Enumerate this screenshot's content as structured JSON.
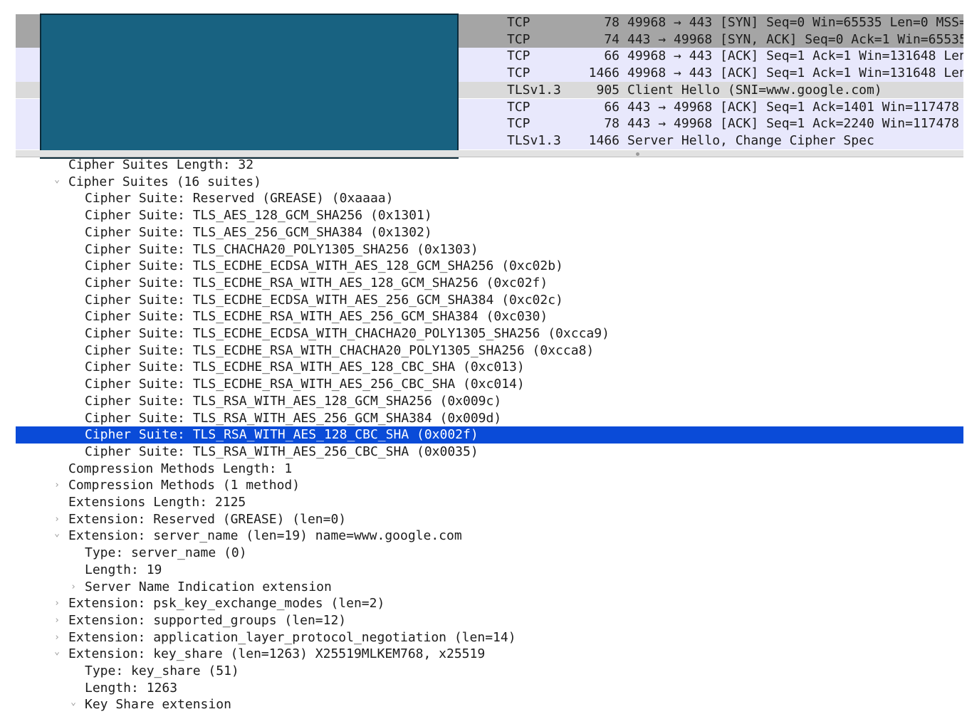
{
  "packet_list": {
    "rows": [
      {
        "protocol": "TCP",
        "length": "78",
        "info": "49968 → 443 [SYN] Seq=0 Win=65535 Len=0 MSS=",
        "style": "syn"
      },
      {
        "protocol": "TCP",
        "length": "74",
        "info": "443 → 49968 [SYN, ACK] Seq=0 Ack=1 Win=65535",
        "style": "syn"
      },
      {
        "protocol": "TCP",
        "length": "66",
        "info": "49968 → 443 [ACK] Seq=1 Ack=1 Win=131648 Len",
        "style": "tcp"
      },
      {
        "protocol": "TCP",
        "length": "1466",
        "info": "49968 → 443 [ACK] Seq=1 Ack=1 Win=131648 Len",
        "style": "tcp"
      },
      {
        "protocol": "TLSv1.3",
        "length": "905",
        "info": "Client Hello (SNI=www.google.com)",
        "style": "tls"
      },
      {
        "protocol": "TCP",
        "length": "66",
        "info": "443 → 49968 [ACK] Seq=1 Ack=1401 Win=117478",
        "style": "tcp"
      },
      {
        "protocol": "TCP",
        "length": "78",
        "info": "443 → 49968 [ACK] Seq=1 Ack=2240 Win=117478",
        "style": "tcp"
      },
      {
        "protocol": "TLSv1.3",
        "length": "1466",
        "info": "Server Hello, Change Cipher Spec",
        "style": "tcp"
      }
    ]
  },
  "details": {
    "rows": [
      {
        "text": "Cipher Suites Length: 32",
        "level": 1,
        "twisty": ""
      },
      {
        "text": "Cipher Suites (16 suites)",
        "level": 1,
        "twisty": "expanded"
      },
      {
        "text": "Cipher Suite: Reserved (GREASE) (0xaaaa)",
        "level": 2,
        "twisty": ""
      },
      {
        "text": "Cipher Suite: TLS_AES_128_GCM_SHA256 (0x1301)",
        "level": 2,
        "twisty": ""
      },
      {
        "text": "Cipher Suite: TLS_AES_256_GCM_SHA384 (0x1302)",
        "level": 2,
        "twisty": ""
      },
      {
        "text": "Cipher Suite: TLS_CHACHA20_POLY1305_SHA256 (0x1303)",
        "level": 2,
        "twisty": ""
      },
      {
        "text": "Cipher Suite: TLS_ECDHE_ECDSA_WITH_AES_128_GCM_SHA256 (0xc02b)",
        "level": 2,
        "twisty": ""
      },
      {
        "text": "Cipher Suite: TLS_ECDHE_RSA_WITH_AES_128_GCM_SHA256 (0xc02f)",
        "level": 2,
        "twisty": ""
      },
      {
        "text": "Cipher Suite: TLS_ECDHE_ECDSA_WITH_AES_256_GCM_SHA384 (0xc02c)",
        "level": 2,
        "twisty": ""
      },
      {
        "text": "Cipher Suite: TLS_ECDHE_RSA_WITH_AES_256_GCM_SHA384 (0xc030)",
        "level": 2,
        "twisty": ""
      },
      {
        "text": "Cipher Suite: TLS_ECDHE_ECDSA_WITH_CHACHA20_POLY1305_SHA256 (0xcca9)",
        "level": 2,
        "twisty": ""
      },
      {
        "text": "Cipher Suite: TLS_ECDHE_RSA_WITH_CHACHA20_POLY1305_SHA256 (0xcca8)",
        "level": 2,
        "twisty": ""
      },
      {
        "text": "Cipher Suite: TLS_ECDHE_RSA_WITH_AES_128_CBC_SHA (0xc013)",
        "level": 2,
        "twisty": ""
      },
      {
        "text": "Cipher Suite: TLS_ECDHE_RSA_WITH_AES_256_CBC_SHA (0xc014)",
        "level": 2,
        "twisty": ""
      },
      {
        "text": "Cipher Suite: TLS_RSA_WITH_AES_128_GCM_SHA256 (0x009c)",
        "level": 2,
        "twisty": ""
      },
      {
        "text": "Cipher Suite: TLS_RSA_WITH_AES_256_GCM_SHA384 (0x009d)",
        "level": 2,
        "twisty": ""
      },
      {
        "text": "Cipher Suite: TLS_RSA_WITH_AES_128_CBC_SHA (0x002f)",
        "level": 2,
        "twisty": "",
        "selected": true
      },
      {
        "text": "Cipher Suite: TLS_RSA_WITH_AES_256_CBC_SHA (0x0035)",
        "level": 2,
        "twisty": ""
      },
      {
        "text": "Compression Methods Length: 1",
        "level": 1,
        "twisty": ""
      },
      {
        "text": "Compression Methods (1 method)",
        "level": 1,
        "twisty": "collapsed"
      },
      {
        "text": "Extensions Length: 2125",
        "level": 1,
        "twisty": ""
      },
      {
        "text": "Extension: Reserved (GREASE) (len=0)",
        "level": 1,
        "twisty": "collapsed"
      },
      {
        "text": "Extension: server_name (len=19) name=www.google.com",
        "level": 1,
        "twisty": "expanded"
      },
      {
        "text": "Type: server_name (0)",
        "level": 2,
        "twisty": ""
      },
      {
        "text": "Length: 19",
        "level": 2,
        "twisty": ""
      },
      {
        "text": "Server Name Indication extension",
        "level": 2,
        "twisty": "collapsed"
      },
      {
        "text": "Extension: psk_key_exchange_modes (len=2)",
        "level": 1,
        "twisty": "collapsed"
      },
      {
        "text": "Extension: supported_groups (len=12)",
        "level": 1,
        "twisty": "collapsed"
      },
      {
        "text": "Extension: application_layer_protocol_negotiation (len=14)",
        "level": 1,
        "twisty": "collapsed"
      },
      {
        "text": "Extension: key_share (len=1263) X25519MLKEM768, x25519",
        "level": 1,
        "twisty": "expanded"
      },
      {
        "text": "Type: key_share (51)",
        "level": 2,
        "twisty": ""
      },
      {
        "text": "Length: 1263",
        "level": 2,
        "twisty": ""
      },
      {
        "text": "Key Share extension",
        "level": 2,
        "twisty": "expanded"
      }
    ]
  },
  "icons": {
    "expanded": "chevron-down-icon",
    "collapsed": "chevron-right-icon"
  },
  "colors": {
    "selection": "#0a4bd8",
    "redaction": "#186281",
    "syn_row": "#a5a5a5",
    "tcp_row": "#e8e8fc",
    "tls_row": "#dadada"
  }
}
